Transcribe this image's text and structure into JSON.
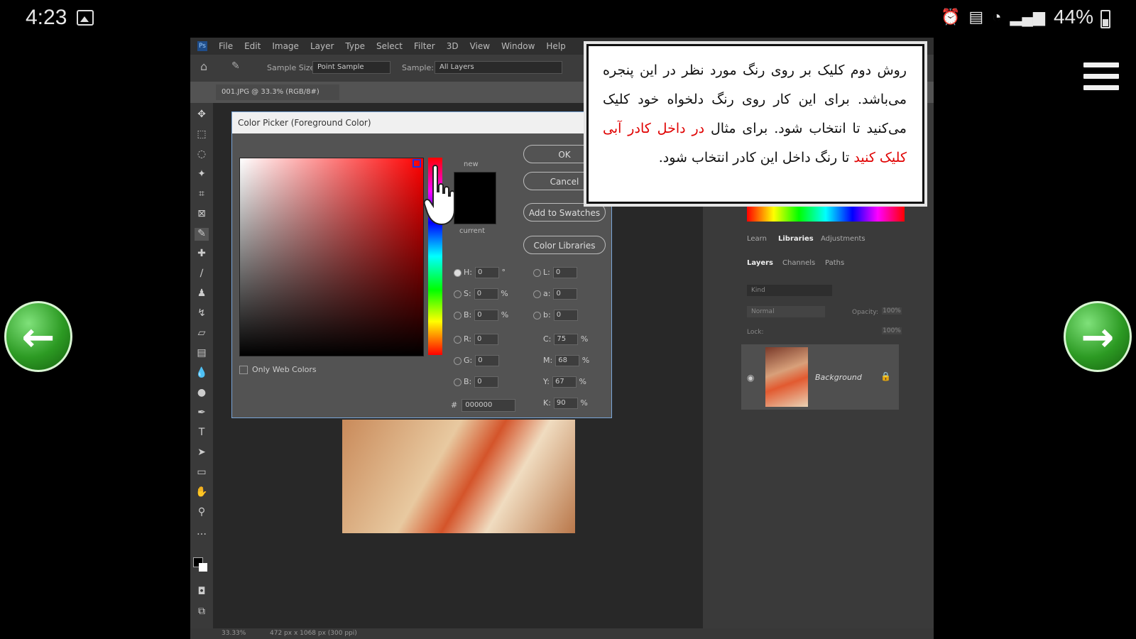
{
  "status_bar": {
    "time": "4:23",
    "battery": "44%"
  },
  "nav": {
    "prev_glyph": "←",
    "next_glyph": "→"
  },
  "ps": {
    "menu": [
      "File",
      "Edit",
      "Image",
      "Layer",
      "Type",
      "Select",
      "Filter",
      "3D",
      "View",
      "Window",
      "Help"
    ],
    "options": {
      "sample_size_label": "Sample Size:",
      "sample_size_value": "Point Sample",
      "sample_label": "Sample:",
      "sample_value": "All Layers"
    },
    "doc_tab": "001.JPG @ 33.3% (RGB/8#)",
    "panels": {
      "tabs_top": [
        "Learn",
        "Libraries",
        "Adjustments"
      ],
      "tabs_layers": [
        "Layers",
        "Channels",
        "Paths"
      ],
      "layer_search": "Kind",
      "blend_mode": "Normal",
      "opacity_label": "Opacity:",
      "opacity_value": "100%",
      "lock_label": "Lock:",
      "fill_value": "100%",
      "layer_name": "Background"
    },
    "statusbar": {
      "zoom": "33.33%",
      "size": "472 px x 1068 px (300 ppi)"
    }
  },
  "dialog": {
    "title": "Color Picker (Foreground Color)",
    "new_label": "new",
    "current_label": "current",
    "ok_label": "OK",
    "cancel_label": "Cancel",
    "add_swatches_label": "Add to Swatches",
    "color_libraries_label": "Color Libraries",
    "only_web_colors": "Only Web Colors",
    "fields_left": [
      {
        "label": "H:",
        "value": "0",
        "unit": "°"
      },
      {
        "label": "S:",
        "value": "0",
        "unit": "%"
      },
      {
        "label": "B:",
        "value": "0",
        "unit": "%"
      },
      {
        "label": "R:",
        "value": "0",
        "unit": ""
      },
      {
        "label": "G:",
        "value": "0",
        "unit": ""
      },
      {
        "label": "B:",
        "value": "0",
        "unit": ""
      }
    ],
    "fields_lab": [
      {
        "label": "L:",
        "value": "0"
      },
      {
        "label": "a:",
        "value": "0"
      },
      {
        "label": "b:",
        "value": "0"
      }
    ],
    "fields_cmyk": [
      {
        "label": "C:",
        "value": "75",
        "unit": "%"
      },
      {
        "label": "M:",
        "value": "68",
        "unit": "%"
      },
      {
        "label": "Y:",
        "value": "67",
        "unit": "%"
      },
      {
        "label": "K:",
        "value": "90",
        "unit": "%"
      }
    ],
    "hex_label": "#",
    "hex_value": "000000"
  },
  "tip": {
    "part1": "روش دوم کلیک بر روی رنگ مورد نظر در این پنجره می‌باشد. برای این کار روی رنگ دلخواه خود کلیک می‌کنید تا انتخاب شود. برای مثال ",
    "red1": "در داخل کادر آبی کلیک کنید",
    "part2": " تا رنگ داخل این کادر انتخاب شود."
  },
  "colors": {
    "accent_red": "#e00000",
    "dialog_border": "#7aa6d8",
    "nav_green": "#2c9a23"
  }
}
